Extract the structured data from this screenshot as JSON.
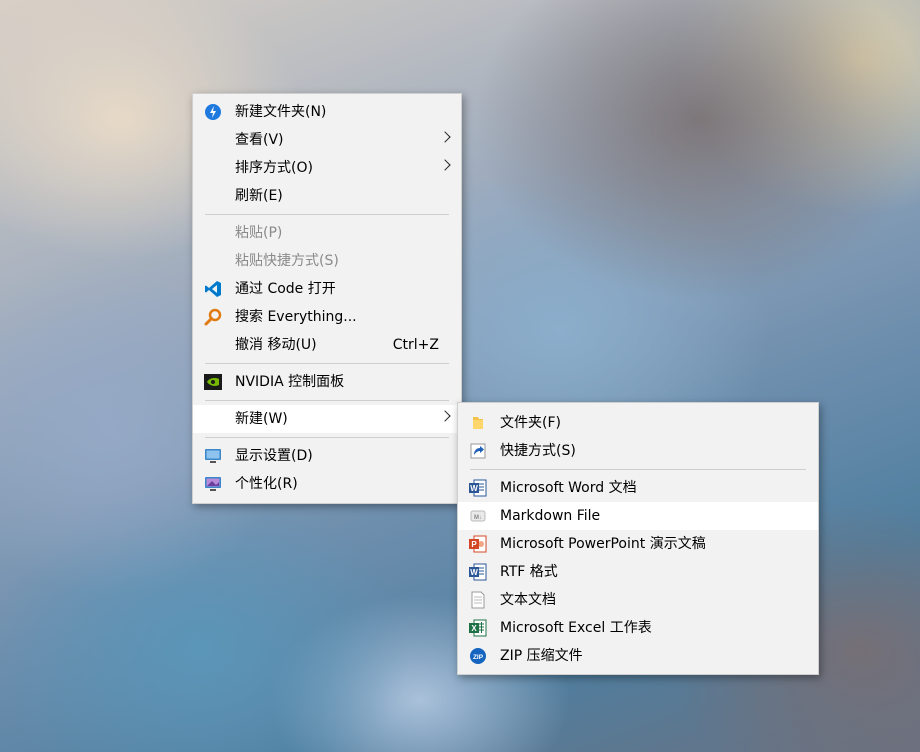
{
  "main_menu": {
    "items": [
      {
        "label": "新建文件夹(N)",
        "icon": "new-folder-icon"
      },
      {
        "label": "查看(V)",
        "submenu": true
      },
      {
        "label": "排序方式(O)",
        "submenu": true
      },
      {
        "label": "刷新(E)"
      },
      {
        "label": "粘贴(P)",
        "disabled": true
      },
      {
        "label": "粘贴快捷方式(S)",
        "disabled": true
      },
      {
        "label": "通过 Code 打开",
        "icon": "vscode-icon"
      },
      {
        "label": "搜索 Everything...",
        "icon": "everything-search-icon"
      },
      {
        "label": "撤消 移动(U)",
        "shortcut": "Ctrl+Z"
      },
      {
        "label": "NVIDIA 控制面板",
        "icon": "nvidia-icon"
      },
      {
        "label": "新建(W)",
        "submenu": true,
        "active": true
      },
      {
        "label": "显示设置(D)",
        "icon": "display-settings-icon"
      },
      {
        "label": "个性化(R)",
        "icon": "personalize-icon"
      }
    ]
  },
  "new_submenu": {
    "items": [
      {
        "label": "文件夹(F)",
        "icon": "folder-icon"
      },
      {
        "label": "快捷方式(S)",
        "icon": "shortcut-icon"
      },
      {
        "label": "Microsoft Word 文档",
        "icon": "word-icon"
      },
      {
        "label": "Markdown File",
        "icon": "markdown-icon",
        "active": true
      },
      {
        "label": "Microsoft PowerPoint 演示文稿",
        "icon": "powerpoint-icon"
      },
      {
        "label": "RTF 格式",
        "icon": "rtf-icon"
      },
      {
        "label": "文本文档",
        "icon": "text-document-icon"
      },
      {
        "label": "Microsoft Excel 工作表",
        "icon": "excel-icon"
      },
      {
        "label": "ZIP 压缩文件",
        "icon": "zip-icon"
      }
    ]
  },
  "colors": {
    "menu_background": "#f2f2f2",
    "hover_background": "#ffffff",
    "disabled_text": "#8a8a8a",
    "word_blue": "#2b5797",
    "powerpoint_orange": "#d24726",
    "excel_green": "#1e7145",
    "nvidia_green": "#76b900",
    "vscode_blue": "#007acc"
  }
}
